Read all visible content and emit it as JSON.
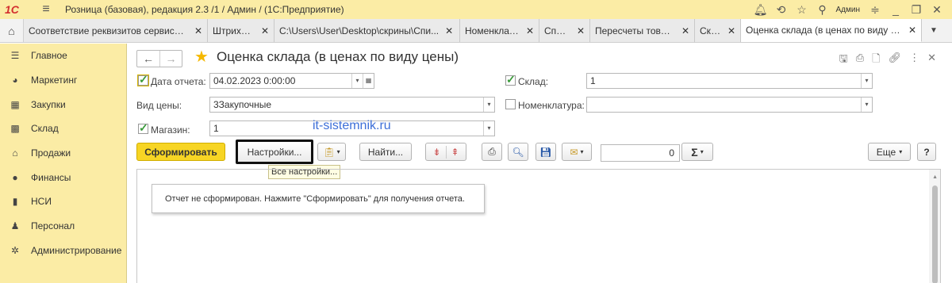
{
  "titlebar": {
    "logo": "1С",
    "title": "Розница (базовая), редакция 2.3 /1 / Админ /  (1С:Предприятие)",
    "user": "Админ"
  },
  "tabs": [
    {
      "label": "Соответствие реквизитов сервиса ..."
    },
    {
      "label": "Штрихкоды"
    },
    {
      "label": "C:\\Users\\User\\Desktop\\скрины\\Спи..."
    },
    {
      "label": "Номенклатура"
    },
    {
      "label": "Список"
    },
    {
      "label": "Пересчеты товаров"
    },
    {
      "label": "Склад"
    },
    {
      "label": "Оценка склада (в ценах по виду це..."
    }
  ],
  "sidebar": {
    "items": [
      {
        "label": "Главное",
        "icon": "menu-icon"
      },
      {
        "label": "Маркетинг",
        "icon": "marketing-icon"
      },
      {
        "label": "Закупки",
        "icon": "purchases-icon"
      },
      {
        "label": "Склад",
        "icon": "warehouse-icon"
      },
      {
        "label": "Продажи",
        "icon": "sales-icon"
      },
      {
        "label": "Финансы",
        "icon": "finance-icon"
      },
      {
        "label": "НСИ",
        "icon": "reference-icon"
      },
      {
        "label": "Персонал",
        "icon": "person-icon"
      },
      {
        "label": "Администрирование",
        "icon": "gear-icon"
      }
    ]
  },
  "page": {
    "title": "Оценка склада (в ценах по виду цены)"
  },
  "form": {
    "report_date_label": "Дата отчета:",
    "report_date_value": "04.02.2023  0:00:00",
    "warehouse_label": "Склад:",
    "warehouse_value": "1",
    "price_type_label": "Вид цены:",
    "price_type_value": "3Закупочные",
    "nomenclature_label": "Номенклатура:",
    "nomenclature_value": "",
    "store_label": "Магазин:",
    "store_value": "1",
    "watermark": "it-sistemnik.ru"
  },
  "toolbar": {
    "generate_label": "Сформировать",
    "settings_label": "Настройки...",
    "settings_tooltip": "Все настройки...",
    "find_label": "Найти...",
    "sum_value": "0",
    "more_label": "Еще",
    "help_label": "?"
  },
  "report": {
    "message": "Отчет не сформирован. Нажмите \"Сформировать\" для получения отчета."
  }
}
